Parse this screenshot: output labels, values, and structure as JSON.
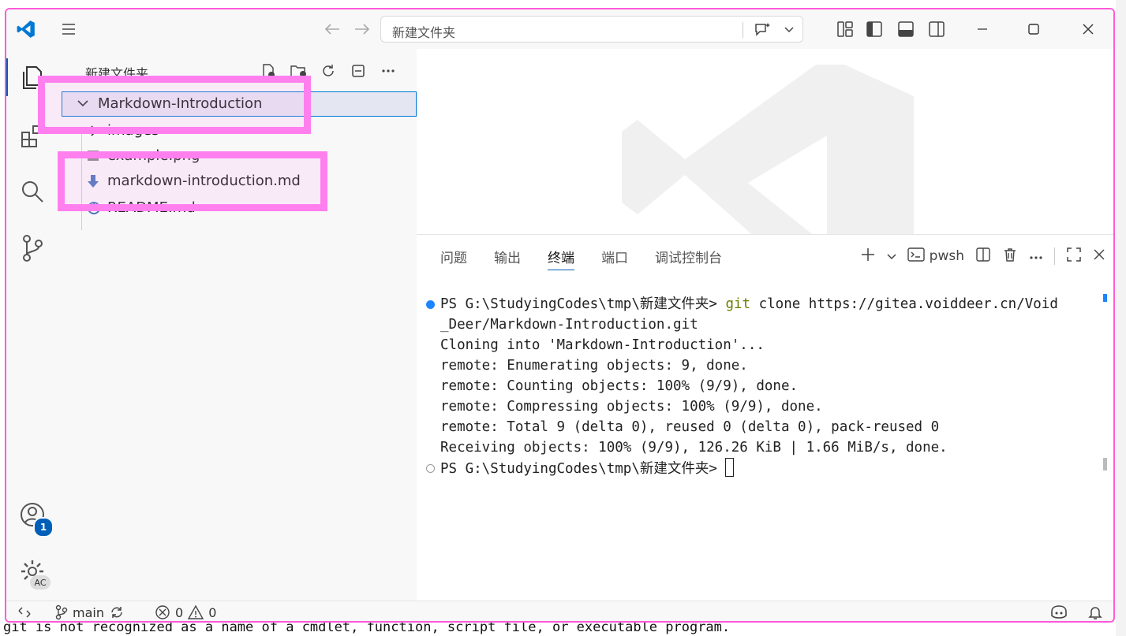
{
  "background": {
    "bottom_text": "git  is not recognized as a name of a cmdlet, function, script file, or executable program."
  },
  "titlebar": {
    "search_placeholder": "新建文件夹",
    "icons": [
      "vscode-logo",
      "menu-icon",
      "back-arrow-icon",
      "forward-arrow-icon",
      "copilot-chat-icon",
      "chevron-down-icon",
      "customize-layout-icon",
      "toggle-sidebar-icon",
      "toggle-panel-icon",
      "toggle-secondary-sidebar-icon",
      "minimize-icon",
      "maximize-icon",
      "close-icon"
    ]
  },
  "activity_bar": {
    "items": [
      "explorer",
      "extensions",
      "search",
      "source-control"
    ],
    "accounts_badge": "1",
    "manage_badge": "AC"
  },
  "sidebar": {
    "title": "新建文件夹",
    "tree": [
      {
        "label": "Markdown-Introduction",
        "type": "folder-open"
      },
      {
        "label": "images",
        "type": "folder"
      },
      {
        "label": "example.png",
        "type": "image"
      },
      {
        "label": "markdown-introduction.md",
        "type": "markdown"
      },
      {
        "label": "README.md",
        "type": "info"
      }
    ]
  },
  "panel": {
    "tabs": [
      "问题",
      "输出",
      "终端",
      "端口",
      "调试控制台"
    ],
    "active_tab": "终端",
    "shell": "pwsh",
    "terminal": {
      "prompt1": "PS G:\\StudyingCodes\\tmp\\新建文件夹> ",
      "cmd": "git",
      "cmd_rest": " clone https://gitea.voiddeer.cn/Void",
      "wrap": "_Deer/Markdown-Introduction.git",
      "out1": "Cloning into 'Markdown-Introduction'...",
      "out2": "remote: Enumerating objects: 9, done.",
      "out3": "remote: Counting objects: 100% (9/9), done.",
      "out4": "remote: Compressing objects: 100% (9/9), done.",
      "out5": "remote: Total 9 (delta 0), reused 0 (delta 0), pack-reused 0",
      "out6": "Receiving objects: 100% (9/9), 126.26 KiB | 1.66 MiB/s, done.",
      "prompt2": "PS G:\\StudyingCodes\\tmp\\新建文件夹> "
    }
  },
  "statusbar": {
    "branch": "main",
    "errors": "0",
    "warnings": "0"
  },
  "colors": {
    "accent": "#005fb8",
    "highlight": "#ff7fef",
    "window_border": "#ff5ad9",
    "git_cmd": "#6a7f00"
  }
}
